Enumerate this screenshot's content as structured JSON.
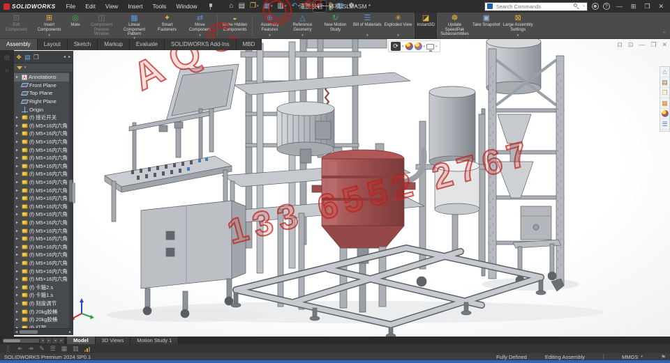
{
  "app": {
    "name": "SOLIDWORKS",
    "title": "灌胶装管一体机.SLDASM *",
    "edition": "SOLIDWORKS Premium 2024 SP0.1"
  },
  "menubar": {
    "menus": [
      "File",
      "Edit",
      "View",
      "Insert",
      "Tools",
      "Window"
    ],
    "toolbar_icons": [
      {
        "name": "home"
      },
      {
        "name": "new-document"
      },
      {
        "name": "open",
        "caret": true
      },
      {
        "name": "save",
        "caret": true
      },
      {
        "name": "print",
        "caret": true
      },
      {
        "name": "undo",
        "caret": true
      },
      {
        "name": "redo",
        "dim": true
      },
      {
        "name": "select",
        "caret": true,
        "active": true
      },
      {
        "name": "rebuild"
      },
      {
        "name": "file-properties"
      },
      {
        "name": "options",
        "caret": true
      }
    ],
    "search_placeholder": "Search Commands",
    "right_icons": [
      {
        "name": "account"
      },
      {
        "name": "help"
      },
      {
        "name": "minimize"
      },
      {
        "name": "maximize"
      },
      {
        "name": "restore"
      },
      {
        "name": "close"
      }
    ]
  },
  "ribbon": {
    "collapse_glyph": "ˆ",
    "groups": [
      {
        "buttons": [
          {
            "label": "Edit Component",
            "icon": "edit-component",
            "disabled": true
          },
          {
            "label": "Insert Components",
            "icon": "insert-components",
            "caret": true
          },
          {
            "label": "Mate",
            "icon": "mate"
          },
          {
            "label": "Component Preview Window",
            "icon": "component-preview",
            "disabled": true
          },
          {
            "label": "Linear Component Pattern",
            "icon": "linear-pattern",
            "caret": true
          },
          {
            "label": "Smart Fasteners",
            "icon": "smart-fasteners"
          },
          {
            "label": "Move Component",
            "icon": "move-component",
            "caret": true
          }
        ]
      },
      {
        "buttons": [
          {
            "label": "Show Hidden Components",
            "icon": "show-hidden"
          }
        ]
      },
      {
        "buttons": [
          {
            "label": "Assembly Features",
            "icon": "assembly-features",
            "caret": true
          },
          {
            "label": "Reference Geometry",
            "icon": "reference-geometry",
            "caret": true
          },
          {
            "label": "New Motion Study",
            "icon": "new-motion-study"
          },
          {
            "label": "Bill of Materials",
            "icon": "bom",
            "caret": true
          },
          {
            "label": "Exploded View",
            "icon": "exploded-view",
            "caret": true
          }
        ]
      },
      {
        "buttons": [
          {
            "label": "Instant3D",
            "icon": "instant3d",
            "active": true
          }
        ]
      },
      {
        "buttons": [
          {
            "label": "Update SpeedPak Subassemblies",
            "icon": "speedpak"
          },
          {
            "label": "Take Snapshot",
            "icon": "snapshot"
          },
          {
            "label": "Large Assembly Settings",
            "icon": "large-assembly",
            "caret": true
          }
        ]
      }
    ]
  },
  "command_tabs": {
    "active": "Assembly",
    "items": [
      "Assembly",
      "Layout",
      "Sketch",
      "Markup",
      "Evaluate",
      "SOLIDWORKS Add-Ins",
      "MBD"
    ]
  },
  "feature_tree": {
    "items": [
      {
        "label": "Annotations",
        "icon": "annotations",
        "arrow": true,
        "selected": true
      },
      {
        "label": "Front Plane",
        "icon": "plane"
      },
      {
        "label": "Top Plane",
        "icon": "plane"
      },
      {
        "label": "Right Plane",
        "icon": "plane"
      },
      {
        "label": "Origin",
        "icon": "origin"
      },
      {
        "label": "(f) 接近开关",
        "icon": "part",
        "arrow": true
      },
      {
        "label": "(f) M5×16内六角",
        "icon": "part",
        "arrow": true
      },
      {
        "label": "(f) M5×16内六角",
        "icon": "part",
        "arrow": true
      },
      {
        "label": "(f) M5×16内六角",
        "icon": "part",
        "arrow": true
      },
      {
        "label": "(f) M5×16内六角",
        "icon": "part",
        "arrow": true
      },
      {
        "label": "(f) M5×16内六角",
        "icon": "part",
        "arrow": true
      },
      {
        "label": "(f) M5×16内六角",
        "icon": "part",
        "arrow": true
      },
      {
        "label": "(f) M5×16内六角",
        "icon": "part",
        "arrow": true
      },
      {
        "label": "(f) M5×16内六角",
        "icon": "part",
        "arrow": true
      },
      {
        "label": "(f) M5×16内六角",
        "icon": "part",
        "arrow": true
      },
      {
        "label": "(f) M5×16内六角",
        "icon": "part",
        "arrow": true
      },
      {
        "label": "(f) M5×16内六角",
        "icon": "part",
        "arrow": true
      },
      {
        "label": "(f) M5×16内六角",
        "icon": "part",
        "arrow": true
      },
      {
        "label": "(f) M5×16内六角",
        "icon": "part",
        "arrow": true
      },
      {
        "label": "(f) M5×16内六角",
        "icon": "part",
        "arrow": true
      },
      {
        "label": "(f) M5×16内六角",
        "icon": "part",
        "arrow": true
      },
      {
        "label": "(f) M5×16内六角",
        "icon": "part",
        "arrow": true
      },
      {
        "label": "(f) M5×16内六角",
        "icon": "part",
        "arrow": true
      },
      {
        "label": "(f) M5×16内六角",
        "icon": "part",
        "arrow": true
      },
      {
        "label": "(f) M5×16内六角",
        "icon": "part",
        "arrow": true
      },
      {
        "label": "(f) M5×16内六角",
        "icon": "part",
        "arrow": true
      },
      {
        "label": "(f) 卡箍2.s",
        "icon": "part",
        "arrow": true
      },
      {
        "label": "(f) 卡箍1.s",
        "icon": "part",
        "arrow": true
      },
      {
        "label": "(f) 刻度调节",
        "icon": "part",
        "arrow": true
      },
      {
        "label": "(f) 20kg胶桶",
        "icon": "part",
        "arrow": true
      },
      {
        "label": "(f) 20kg胶桶",
        "icon": "part",
        "arrow": true
      },
      {
        "label": "(f) 灯架",
        "icon": "part",
        "arrow": true
      }
    ]
  },
  "viewport": {
    "watermark_line1": "AQC OJKH",
    "watermark_line2": "133 6552 2767",
    "headsup_icons": [
      "view-orientation",
      "appearances",
      "apply-scene",
      "display-settings"
    ],
    "doc_window_icons": [
      "restore-group",
      "new-window",
      "minimize-doc",
      "restore-doc",
      "close-doc"
    ],
    "task_pane_icons": [
      "resources",
      "design-library",
      "file-explorer",
      "view-palette",
      "appearances-scenes",
      "custom-properties"
    ]
  },
  "bottom_tabs": {
    "active": "Model",
    "items": [
      "Model",
      "3D Views",
      "Motion Study 1"
    ]
  },
  "status_bar": {
    "left": "SOLIDWORKS Premium 2024 SP0.1",
    "state": "Fully Defined",
    "mode": "Editing Assembly",
    "units": "MMGS"
  },
  "colors": {
    "taskbar_blue": "#2c66b8",
    "watermark_red": "#c31c16",
    "vessel_red": "#9c4e4e",
    "ribbon_gray": "#4b4b4b"
  }
}
